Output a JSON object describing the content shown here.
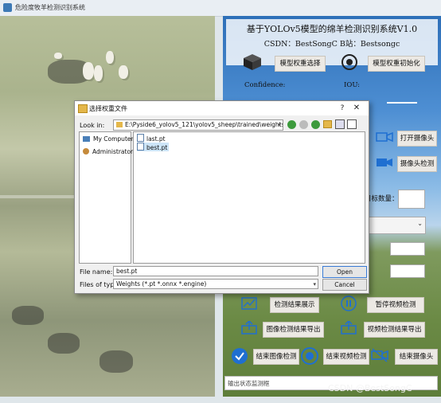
{
  "window": {
    "title": "危险度牧羊检测识别系统"
  },
  "header": {
    "title": "基于YOLOv5模型的绵羊检测识别系统V1.0",
    "subtitle": "CSDN：BestSongC   B站：Bestsongc"
  },
  "controls": {
    "select_model": "模型权重选择",
    "init_model": "模型权重初始化",
    "confidence_label": "Confidence:",
    "iou_label": "IOU:",
    "open_camera": "打开摄像头",
    "camera_detect": "摄像头检测",
    "target_count_label": "目标数量：",
    "show_result": "检测结果展示",
    "pause_video": "暂停视频检测",
    "export_image": "图像检测结果导出",
    "export_video": "视频检测结果导出",
    "end_image": "结束图像检测",
    "end_video": "结束视频检测",
    "end_camera": "结束摄像头"
  },
  "status": {
    "text": "输出状态监测框"
  },
  "watermark": "CSDN @BestSongC",
  "dialog": {
    "title": "选择权重文件",
    "look_in_label": "Look in:",
    "look_in_path": "E:\\Pyside6_yolov5_121\\yolov5_sheep\\trained\\weights",
    "places": [
      "My Computer",
      "Administrator"
    ],
    "files": [
      "last.pt",
      "best.pt"
    ],
    "selected_file": "best.pt",
    "file_name_label": "File name:",
    "file_name_value": "best.pt",
    "file_type_label": "Files of type:",
    "file_type_value": "Weights (*.pt *.onnx *.engine)",
    "open_button": "Open",
    "cancel_button": "Cancel",
    "help_glyph": "?",
    "close_glyph": "✕"
  },
  "colors": {
    "accent": "#3a7bd5",
    "sky": "#4e8fd3",
    "grass": "#6b8a45"
  }
}
